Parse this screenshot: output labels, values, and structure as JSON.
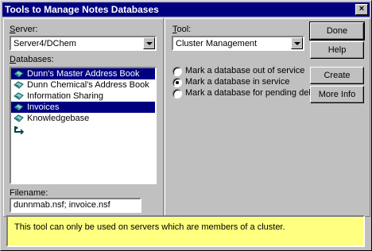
{
  "window": {
    "title": "Tools to Manage Notes Databases",
    "close_glyph": "×"
  },
  "server": {
    "label_u": "S",
    "label_rest": "erver:",
    "value": "Server4/DChem"
  },
  "databases": {
    "label_u": "D",
    "label_rest": "atabases:",
    "items": [
      {
        "label": "Dunn's Master Address Book",
        "selected": true
      },
      {
        "label": "Dunn Chemical's Address Book",
        "selected": false
      },
      {
        "label": "Information Sharing",
        "selected": false
      },
      {
        "label": "Invoices",
        "selected": true
      },
      {
        "label": "Knowledgebase",
        "selected": false
      }
    ],
    "more_icon": "more-databases-icon"
  },
  "filename": {
    "label": "Filename:",
    "value": "dunnmab.nsf; invoice.nsf"
  },
  "tool": {
    "label_u": "T",
    "label_rest": "ool:",
    "value": "Cluster Management",
    "options": [
      {
        "label": "Mark a database out of service",
        "checked": false
      },
      {
        "label": "Mark a database in service",
        "checked": true
      },
      {
        "label": "Mark a database for pending delete",
        "checked": false
      }
    ]
  },
  "buttons": {
    "done": "Done",
    "help": "Help",
    "create": "Create",
    "more_info": "More Info"
  },
  "hint": {
    "text": "This tool can only be used on servers which are members of a cluster."
  },
  "colors": {
    "title_bar": "#000080",
    "selection": "#000080",
    "hint_background": "#ffff80",
    "dialog_face": "#c0c0c0"
  }
}
